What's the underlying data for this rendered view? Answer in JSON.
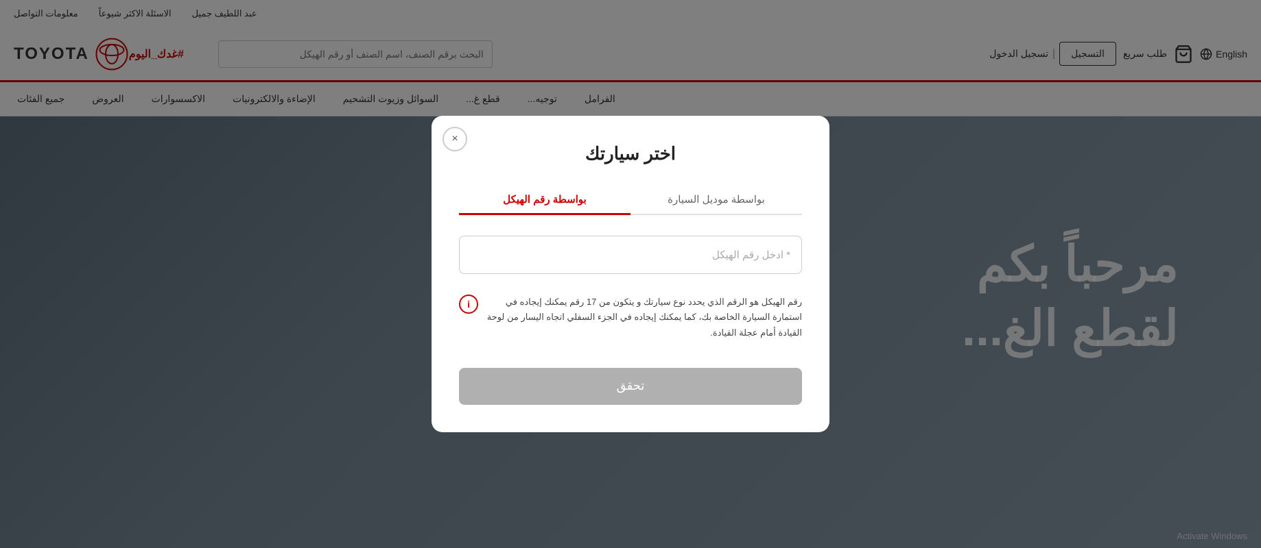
{
  "topbar": {
    "items": [
      {
        "label": "معلومات التواصل",
        "name": "contact-info"
      },
      {
        "label": "الاسئلة الاكثر شيوعاً",
        "name": "faq"
      },
      {
        "label": "عبد اللطيف جميل",
        "name": "brand-name"
      }
    ]
  },
  "header": {
    "logo_text": "TOYOTA",
    "hashtag": "#غدك_اليوم",
    "search_placeholder": "البحث برقم الصنف، اسم الصنف أو رقم الهيكل",
    "lang_label": "English",
    "quick_order_label": "طلب سريع",
    "auth": {
      "register": "التسجيل",
      "separator": "|",
      "login": "تسجيل الدخول"
    }
  },
  "nav": {
    "items": [
      {
        "label": "جميع الفئات",
        "active": false
      },
      {
        "label": "العروض",
        "active": false
      },
      {
        "label": "الاكسسوارات",
        "active": false
      },
      {
        "label": "الإضاءة والالكترونيات",
        "active": false
      },
      {
        "label": "السوائل وزيوت التشحيم",
        "active": false
      },
      {
        "label": "قطع غ...",
        "active": false
      },
      {
        "label": "توجيه...",
        "active": false
      },
      {
        "label": "الفرامل",
        "active": false
      }
    ]
  },
  "modal": {
    "title": "اختر سيارتك",
    "close_label": "×",
    "tabs": [
      {
        "label": "بواسطة رقم الهيكل",
        "id": "vin",
        "active": true
      },
      {
        "label": "بواسطة موديل السيارة",
        "id": "model",
        "active": false
      }
    ],
    "input_placeholder": "* ادخل رقم الهيكل",
    "info_text": "رقم الهيكل هو الرقم الذي يحدد نوع سيارتك و يتكون من 17 رقم يمكنك إيجاده في استمارة السيارة الخاصة بك، كما يمكنك إيجاده في الجزء السفلي اتجاه اليسار من لوحة القيادة أمام عجلة القيادة.",
    "info_link_text": "إيجاده في استمارة السيارة الخاصة بك، كما يمكنك إيجاده في الجزء السفلي",
    "submit_label": "تحقق",
    "cursor_hint": ""
  },
  "background": {
    "welcome_line1": "مرحباً بكم",
    "welcome_line2": "لقطع الغ..."
  },
  "activate_windows": "Activate Windows"
}
